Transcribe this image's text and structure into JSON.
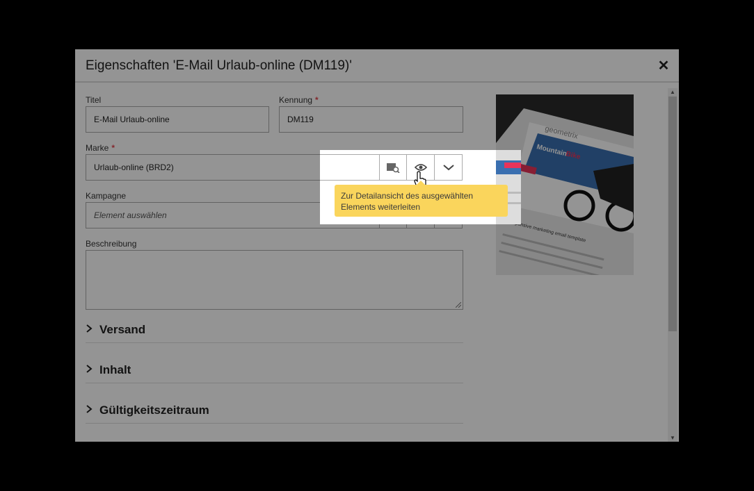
{
  "dialog": {
    "title": "Eigenschaften 'E-Mail Urlaub-online (DM119)'",
    "close_icon": "close-icon"
  },
  "fields": {
    "titel": {
      "label": "Titel",
      "value": "E-Mail Urlaub-online"
    },
    "kennung": {
      "label": "Kennung",
      "required": "*",
      "value": "DM119"
    },
    "marke": {
      "label": "Marke",
      "required": "*",
      "value": "Urlaub-online (BRD2)"
    },
    "kampagne": {
      "label": "Kampagne",
      "placeholder": "Element auswählen"
    },
    "beschreibung": {
      "label": "Beschreibung",
      "value": ""
    }
  },
  "picker_icons": [
    "browse-icon",
    "eye-icon",
    "chevron-down-icon"
  ],
  "sections": [
    {
      "label": "Versand"
    },
    {
      "label": "Inhalt"
    },
    {
      "label": "Gültigkeitszeitraum"
    }
  ],
  "preview": {
    "brand": "geometrix",
    "headline_1": "Mountain",
    "headline_2": "Bike",
    "tagline": "responsive marketing email template"
  },
  "tooltip": {
    "text_line1": "Zur Detailansicht des ausgewählten",
    "text_line2": "Elements weiterleiten"
  },
  "colors": {
    "required": "#e34850",
    "tooltip_bg": "#fad55c",
    "accent_red": "#e8345a"
  }
}
